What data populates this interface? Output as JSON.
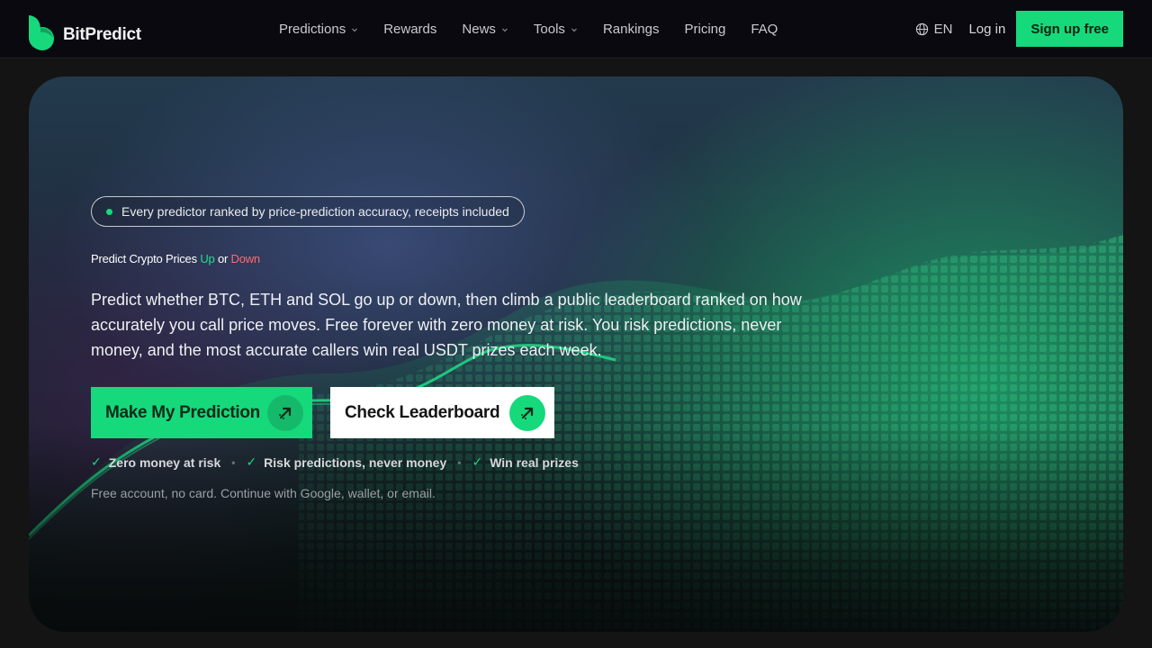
{
  "brand": {
    "name": "BitPredict",
    "accent": "#16d97c",
    "logo_icon": "leaf-logo-icon"
  },
  "nav": {
    "links": [
      {
        "label": "Predictions",
        "dropdown": true
      },
      {
        "label": "Rewards",
        "dropdown": false
      },
      {
        "label": "News",
        "dropdown": true
      },
      {
        "label": "Tools",
        "dropdown": true
      },
      {
        "label": "Rankings",
        "dropdown": false
      },
      {
        "label": "Pricing",
        "dropdown": false
      },
      {
        "label": "FAQ",
        "dropdown": false
      }
    ],
    "language": "EN",
    "language_icon": "globe-icon",
    "login": "Log in",
    "signup": "Sign up free"
  },
  "hero": {
    "pill": "Every predictor ranked by price-prediction accuracy, receipts included",
    "eyebrow": {
      "prefix": "Predict Crypto Prices ",
      "up": "Up",
      "middle": " or ",
      "down": "Down"
    },
    "lede": "Predict whether BTC, ETH and SOL go up or down, then climb a public leaderboard ranked on how accurately you call price moves. Free forever with zero money at risk. You risk predictions, never money, and the most accurate callers win real USDT prizes each week.",
    "cta_primary": "Make My Prediction",
    "cta_secondary": "Check Leaderboard",
    "cta_icon": "arrow-up-right-icon",
    "checks": [
      "Zero money at risk",
      "Risk predictions, never money",
      "Win real prizes"
    ],
    "check_mark": "✓",
    "separator": "•",
    "note": "Free account, no card. Continue with Google, wallet, or email.",
    "colors": {
      "up": "#22e08a",
      "down": "#ff6b6b"
    }
  }
}
